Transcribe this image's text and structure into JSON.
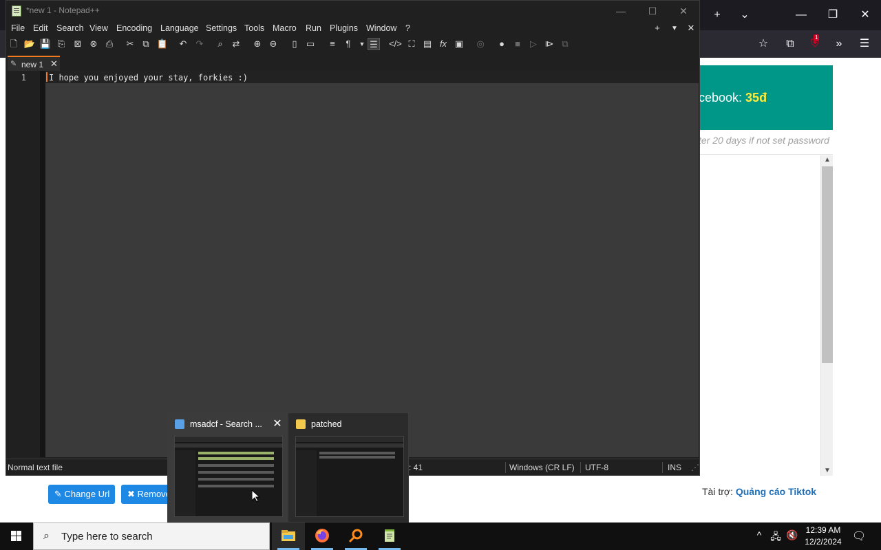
{
  "notepad": {
    "title": "*new 1 - Notepad++",
    "window_controls": {
      "minimize": "—",
      "maximize": "☐",
      "close": "✕"
    },
    "menu": [
      "File",
      "Edit",
      "Search",
      "View",
      "Encoding",
      "Language",
      "Settings",
      "Tools",
      "Macro",
      "Run",
      "Plugins",
      "Window",
      "?"
    ],
    "menu_right": {
      "add": "+",
      "list": "▼",
      "close": "✕"
    },
    "tab": {
      "label": "new 1",
      "close": "✕",
      "pencil": "✎"
    },
    "editor": {
      "line_number": "1",
      "text": "I hope you enjoyed your stay, forkies :)"
    },
    "status": {
      "file_type": "Normal text file",
      "position": ": 41",
      "eol": "Windows (CR LF)",
      "encoding": "UTF-8",
      "mode": "INS"
    }
  },
  "browser": {
    "tab_controls": {
      "new_tab": "+",
      "list_tabs": "⌄",
      "minimize": "—",
      "restore": "❐",
      "close": "✕"
    },
    "extension_badge": "1",
    "promo": {
      "text": "cebook: ",
      "price": "35đ"
    },
    "promo_note": "ter 20 days if not set password",
    "buttons": {
      "change_url": "✎ Change Url",
      "remove": "✖ Remove"
    },
    "sponsor": {
      "label": "Tài trợ: ",
      "link": "Quảng cáo Tiktok"
    }
  },
  "thumbnails": [
    {
      "title": "msadcf - Search ...",
      "close": "✕"
    },
    {
      "title": "patched"
    }
  ],
  "taskbar": {
    "search_placeholder": "Type here to search",
    "clock": {
      "time": "12:39 AM",
      "date": "12/2/2024"
    }
  },
  "colors": {
    "npp_accent": "#f27a1c",
    "promo_bg": "#009688",
    "price_yellow": "#ffeb3b",
    "button_blue": "#1e88e5",
    "taskbar_indicator": "#76b9ed"
  }
}
